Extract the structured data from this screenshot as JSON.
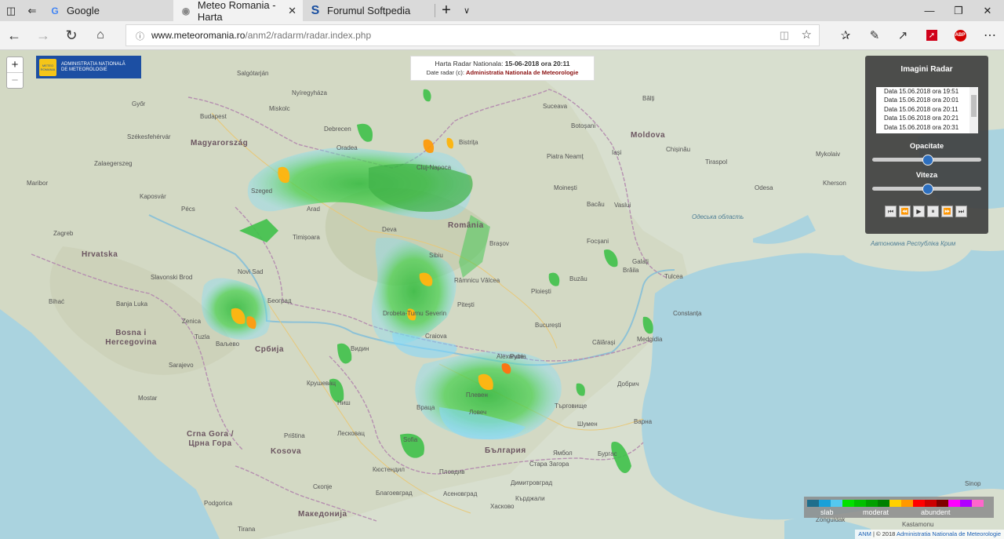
{
  "tabs": [
    {
      "title": "Google",
      "icon": "google-icon"
    },
    {
      "title": "Meteo Romania - Harta",
      "icon": "meteo-icon",
      "active": true
    },
    {
      "title": "Forumul Softpedia",
      "icon": "softpedia-icon"
    }
  ],
  "address": {
    "url_host": "www.meteoromania.ro",
    "url_path": "/anm2/radarm/radar.index.php"
  },
  "logo": {
    "line1": "ADMINISTRAȚIA NAȚIONALĂ",
    "line2": "DE METEOROLOGIE",
    "emblem": "METEO ROMANIA"
  },
  "map_title": {
    "prefix": "Harta Radar Nationala: ",
    "datetime": "15-06-2018 ora 20:11",
    "credit_prefix": "Date radar (c): ",
    "credit_org": "Administratia Nationala de Meteorologie"
  },
  "panel": {
    "heading": "Imagini Radar",
    "frames": [
      "Data 15.06.2018 ora 19:51",
      "Data 15.06.2018 ora 20:01",
      "Data 15.06.2018 ora 20:11",
      "Data 15.06.2018 ora 20:21",
      "Data 15.06.2018 ora 20:31"
    ],
    "opacity_label": "Opacitate",
    "opacity_value": 0.5,
    "speed_label": "Viteza",
    "speed_value": 0.5
  },
  "legend": {
    "labels": [
      "slab",
      "moderat",
      "abundent"
    ],
    "colors": [
      "#1f6e8c",
      "#1aa0d8",
      "#55c8f0",
      "#00e000",
      "#00c000",
      "#00a000",
      "#008000",
      "#ffd000",
      "#ff9800",
      "#ff0000",
      "#cc0000",
      "#800000",
      "#ff00ff",
      "#b000ff",
      "#ff66cc"
    ]
  },
  "attribution": {
    "anm": "ANM",
    "year": " | © 2018 ",
    "org": "Administratia Nationala de Meteorologie"
  },
  "map_labels": {
    "countries": [
      "Magyarország",
      "România",
      "Moldova",
      "Hrvatska",
      "Bosna i Hercegovina",
      "Србија",
      "Crna Gora / Црна Гора",
      "Kosova",
      "България",
      "Македонија"
    ],
    "cities": [
      "Budapest",
      "Győr",
      "Székesfehérvár",
      "Szeged",
      "Debrecen",
      "Nyíregyháza",
      "Miskolc",
      "Salgótarján",
      "Zalaegerszeg",
      "Maribor",
      "Kaposvár",
      "Pécs",
      "Zagreb",
      "Slavonski Brod",
      "Bihać",
      "Banja Luka",
      "Zenica",
      "Sarajevo",
      "Mostar",
      "Tuzla",
      "Novi Sad",
      "Београд",
      "Ваљево",
      "Крушевац",
      "Ниш",
      "Лесковац",
      "Priština",
      "Скопје",
      "Кюстендил",
      "Tirana",
      "Podgorica",
      "Arad",
      "Timișoara",
      "Oradea",
      "Cluj-Napoca",
      "Bistrița",
      "Suceava",
      "Botoșani",
      "Iași",
      "Piatra Neamț",
      "Bacău",
      "Moinești",
      "Vaslui",
      "Deva",
      "Sibiu",
      "Brașov",
      "Buzău",
      "Focșani",
      "Galați",
      "Brăila",
      "Tulcea",
      "Ploiești",
      "București",
      "Pitești",
      "Râmnicu Vâlcea",
      "Drobeta-Turnu Severin",
      "Craiova",
      "Alexandria",
      "Călărași",
      "Medgidia",
      "Constanța",
      "Chișinău",
      "Bălți",
      "Tiraspol",
      "Odesa",
      "Mykolaiv",
      "Kherson",
      "Видин",
      "Враца",
      "Плевен",
      "Ловеч",
      "Търговище",
      "Добрич",
      "Варна",
      "Шумен",
      "Русе",
      "Бургас",
      "Ямбол",
      "Хасково",
      "Пловдив",
      "Sofia",
      "Благоевград",
      "Асеновград",
      "Кърджали",
      "Димитровград",
      "Sinop",
      "Zonguldak",
      "Kastamonu",
      "Стара Загора"
    ],
    "seas": [
      "Одеська область",
      "Автономна Республіка Крим"
    ]
  }
}
